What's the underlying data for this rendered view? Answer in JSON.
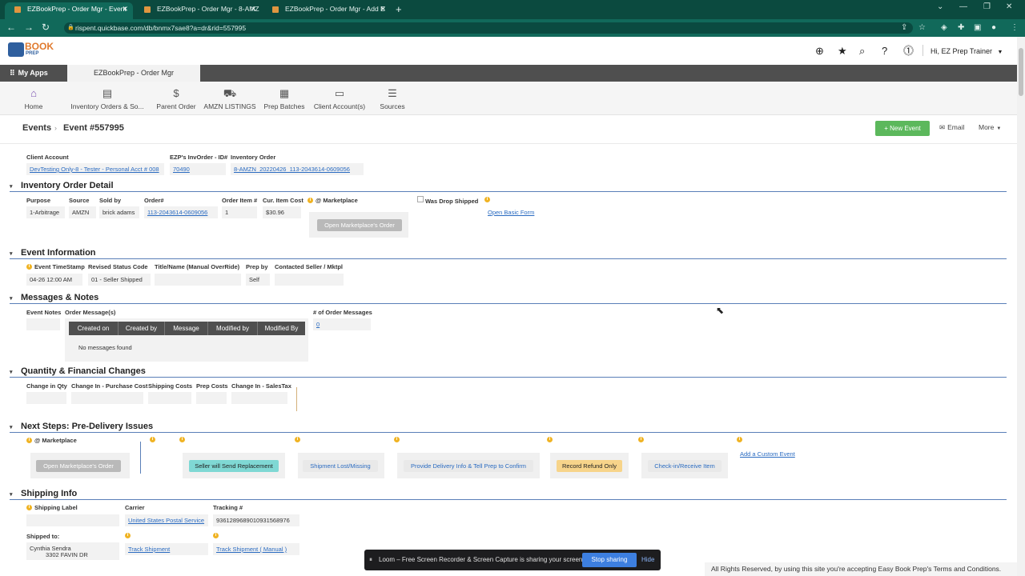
{
  "browser": {
    "tabs": [
      {
        "title": "EZBookPrep - Order Mgr - Event"
      },
      {
        "title": "EZBookPrep - Order Mgr - 8-AMZ"
      },
      {
        "title": "EZBookPrep - Order Mgr - Add E"
      }
    ],
    "url": "rispent.quickbase.com/db/bnmx7sae8?a=dr&rid=557995"
  },
  "header": {
    "logo_book": "BOOK",
    "logo_prep": "PREP",
    "user": "Hi, EZ Prep Trainer",
    "my_apps": "My Apps",
    "app_tab": "EZBookPrep - Order Mgr"
  },
  "toolbar": [
    {
      "label": "Home",
      "icon": "home-icon"
    },
    {
      "label": "Inventory Orders & So...",
      "icon": "table-icon"
    },
    {
      "label": "Parent Order",
      "icon": "dollar-icon"
    },
    {
      "label": "AMZN LISTINGS",
      "icon": "cart-icon"
    },
    {
      "label": "Prep Batches",
      "icon": "boxes-icon"
    },
    {
      "label": "Client Account(s)",
      "icon": "folder-user-icon"
    },
    {
      "label": "Sources",
      "icon": "list-icon"
    }
  ],
  "page": {
    "breadcrumb_root": "Events",
    "title": "Event #557995",
    "new_event": "+ New Event",
    "email": "Email",
    "more": "More"
  },
  "top_fields": {
    "client_account_label": "Client Account",
    "client_account": "DevTesting Only-8 - Tester - Personal Acct # 008",
    "invorder_label": "EZP's InvOrder - ID#",
    "invorder": "70490",
    "inventory_order_label": "Inventory Order",
    "inventory_order": "8-AMZN_20220426_113-2043614-0609056"
  },
  "sections": {
    "inventory": "Inventory Order Detail",
    "event": "Event Information",
    "messages": "Messages & Notes",
    "quantity": "Quantity & Financial Changes",
    "next": "Next Steps: Pre-Delivery Issues",
    "shipping": "Shipping Info"
  },
  "inventory_detail": {
    "purpose_label": "Purpose",
    "purpose": "1-Arbitrage",
    "source_label": "Source",
    "source": "AMZN",
    "soldby_label": "Sold by",
    "soldby": "brick adams",
    "order_label": "Order#",
    "order": "113-2043614-0609056",
    "item_label": "Order Item #",
    "item": "1",
    "cost_label": "Cur. Item Cost",
    "cost": "$30.96",
    "marketplace_label": "@ Marketplace",
    "open_marketplace": "Open Marketplace's Order",
    "drop_label": "Was Drop Shipped",
    "open_basic": "Open Basic Form"
  },
  "event_info": {
    "ts_label": "Event TimeStamp",
    "ts": "04-26 12:00 AM",
    "status_label": "Revised Status Code",
    "status": "01  - Seller Shipped",
    "title_label": "Title/Name  (Manual OverRide)",
    "prep_label": "Prep by",
    "prep": "Self",
    "contacted_label": "Contacted Seller / Mktpl"
  },
  "messages": {
    "notes_label": "Event Notes",
    "order_msgs_label": "Order Message(s)",
    "columns": [
      "Created on",
      "Created by",
      "Message",
      "Modified by",
      "Modified By"
    ],
    "empty": "No messages found",
    "count_label": "# of Order Messages",
    "count": "0"
  },
  "quantity": {
    "labels": [
      "Change in Qty",
      "Change In - Purchase Cost",
      "Shipping Costs",
      "Prep Costs",
      "Change In - SalesTax"
    ]
  },
  "next_steps": {
    "marketplace_label": "@ Marketplace",
    "open_marketplace": "Open Marketplace's Order",
    "seller_replacement": "Seller will Send Replacement",
    "shipment_lost": "Shipment Lost/Missing",
    "provide_delivery": "Provide Delivery Info & Tell Prep to Confirm",
    "record_refund": "Record Refund Only",
    "checkin": "Check-in/Receive Item",
    "custom_event": "Add a Custom Event"
  },
  "shipping": {
    "label_label": "Shipping Label",
    "carrier_label": "Carrier",
    "carrier": "United States Postal Service",
    "tracking_label": "Tracking #",
    "tracking": "9361289689010931568976",
    "shipped_to_label": "Shipped to:",
    "name": "Cynthia Sendra",
    "address": "3302 FAVIN DR",
    "track": "Track Shipment",
    "track_manual": "Track Shipment ( Manual )"
  },
  "footer": {
    "loom_text": "Loom – Free Screen Recorder & Screen Capture is sharing your screen.",
    "stop": "Stop sharing",
    "hide": "Hide",
    "legal": "All Rights Reserved, by using this site you're accepting Easy Book Prep's Terms and Conditions."
  },
  "colors": {
    "chrome": "#0b4a3f",
    "new_event": "#5cb85c",
    "section_rule": "#5a7fb8",
    "replacement": "#7fd8d4",
    "refund": "#f7d48a",
    "info": "#f0b323"
  }
}
